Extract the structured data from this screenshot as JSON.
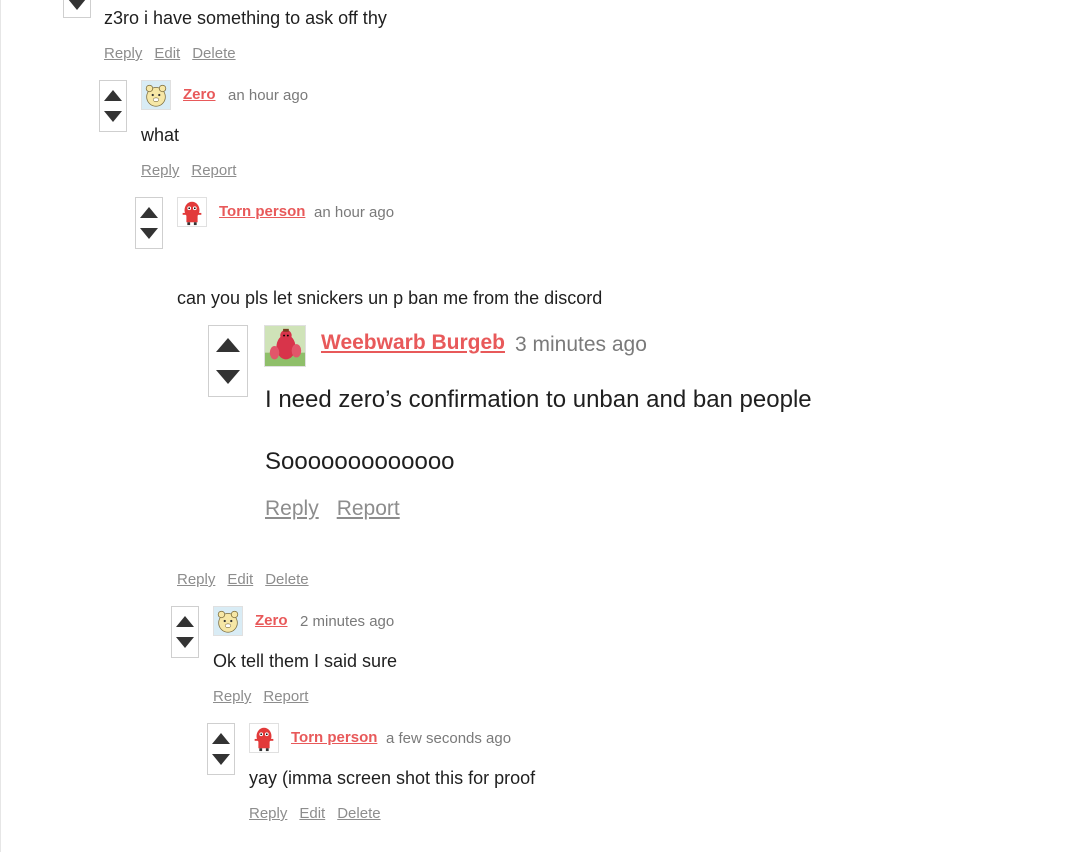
{
  "comments": [
    {
      "body": "z3ro i have something to ask off thy",
      "actions": [
        "Reply",
        "Edit",
        "Delete"
      ]
    },
    {
      "author": "Zero",
      "time": "an hour ago",
      "body": "what",
      "actions": [
        "Reply",
        "Report"
      ]
    },
    {
      "author": "Torn person",
      "time": "an hour ago",
      "body": "can you pls let snickers un p ban me from the discord",
      "actions": [
        "Reply",
        "Edit",
        "Delete"
      ]
    },
    {
      "author": "Weebwarb Burgeb",
      "time": "3 minutes ago",
      "body_lines": [
        "I need zero’s confirmation to unban and ban people",
        "Sooooooooooooo"
      ],
      "actions": [
        "Reply",
        "Report"
      ]
    },
    {
      "author": "Zero",
      "time": "2 minutes ago",
      "body": "Ok tell them I said sure",
      "actions": [
        "Reply",
        "Report"
      ]
    },
    {
      "author": "Torn person",
      "time": "a few seconds ago",
      "body": "yay (imma screen shot this for proof",
      "actions": [
        "Reply",
        "Edit",
        "Delete"
      ]
    }
  ],
  "colors": {
    "author": "#e8595a",
    "link": "#8d8d8d",
    "time": "#7a7a7a",
    "text": "#1f1f1f"
  },
  "icons": {
    "zero_avatar": "cartoon-bear-avatar-icon",
    "torn_avatar": "red-creature-avatar-icon",
    "weebwarb_avatar": "red-dragon-avatar-icon",
    "upvote": "triangle-up-icon",
    "downvote": "triangle-down-icon"
  }
}
